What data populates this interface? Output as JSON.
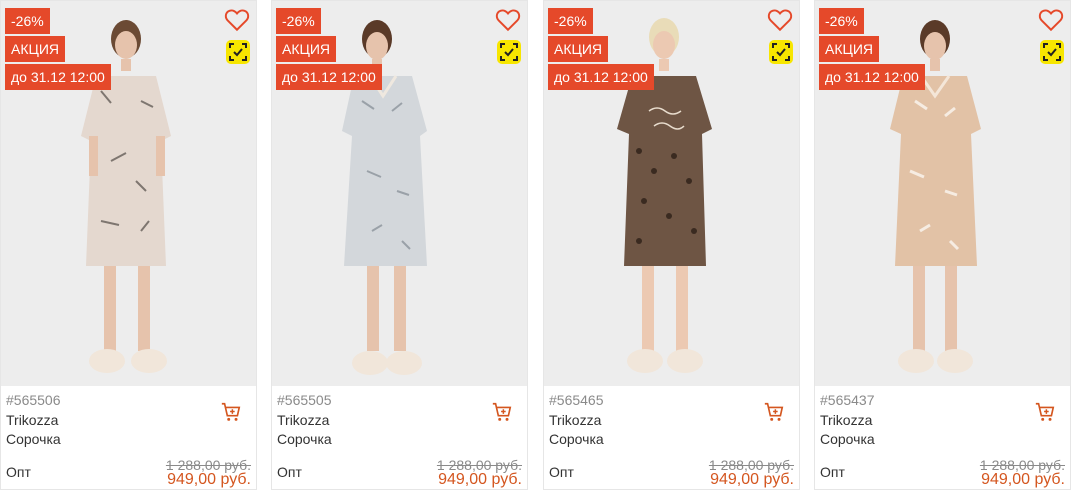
{
  "colors": {
    "accent": "#e5492a",
    "price": "#d4561f",
    "scan_badge": "#f7e600"
  },
  "products": [
    {
      "discount": "-26%",
      "promo": "АКЦИЯ",
      "deadline": "до 31.12 12:00",
      "sku": "#565506",
      "brand": "Trikozza",
      "name": "Сорочка",
      "opt_label": "Опт",
      "old_price": "1 288,00 руб.",
      "new_price": "949,00 руб.",
      "icons": [
        "heart-icon",
        "scan-icon",
        "cart-icon"
      ]
    },
    {
      "discount": "-26%",
      "promo": "АКЦИЯ",
      "deadline": "до 31.12 12:00",
      "sku": "#565505",
      "brand": "Trikozza",
      "name": "Сорочка",
      "opt_label": "Опт",
      "old_price": "1 288,00 руб.",
      "new_price": "949,00 руб.",
      "icons": [
        "heart-icon",
        "scan-icon",
        "cart-icon"
      ]
    },
    {
      "discount": "-26%",
      "promo": "АКЦИЯ",
      "deadline": "до 31.12 12:00",
      "sku": "#565465",
      "brand": "Trikozza",
      "name": "Сорочка",
      "opt_label": "Опт",
      "old_price": "1 288,00 руб.",
      "new_price": "949,00 руб.",
      "icons": [
        "heart-icon",
        "scan-icon",
        "cart-icon"
      ]
    },
    {
      "discount": "-26%",
      "promo": "АКЦИЯ",
      "deadline": "до 31.12 12:00",
      "sku": "#565437",
      "brand": "Trikozza",
      "name": "Сорочка",
      "opt_label": "Опт",
      "old_price": "1 288,00 руб.",
      "new_price": "949,00 руб.",
      "icons": [
        "heart-icon",
        "scan-icon",
        "cart-icon"
      ]
    }
  ]
}
